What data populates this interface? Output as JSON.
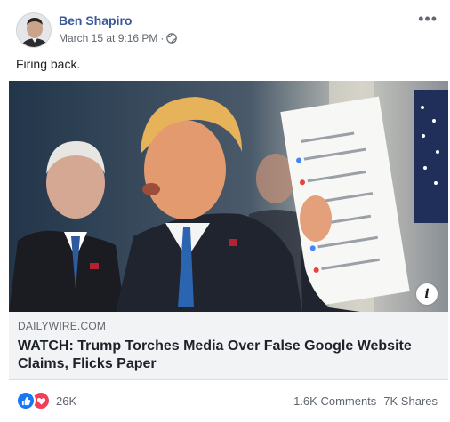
{
  "post": {
    "author": "Ben Shapiro",
    "timestamp": "March 15 at 9:16 PM",
    "separator": "·",
    "privacy_icon": "globe-icon",
    "more_icon": "more-options-icon",
    "text": "Firing back."
  },
  "link_preview": {
    "domain": "DAILYWIRE.COM",
    "headline": "WATCH: Trump Torches Media Over False Google Website Claims, Flicks Paper",
    "info_icon": "i"
  },
  "engagement": {
    "reaction_count": "26K",
    "comments": "1.6K Comments",
    "shares": "7K Shares"
  },
  "colors": {
    "author_link": "#385898",
    "like_blue": "#1877f2",
    "love_red": "#f33e58",
    "link_meta_bg": "#f2f3f5"
  }
}
